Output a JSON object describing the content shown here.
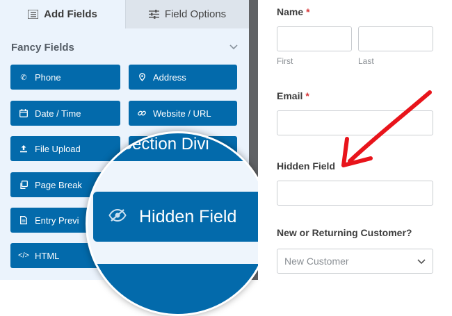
{
  "tabs": [
    {
      "label": "Add Fields",
      "icon": "list-icon"
    },
    {
      "label": "Field Options",
      "icon": "sliders-icon"
    }
  ],
  "section": {
    "title": "Fancy Fields"
  },
  "fields": [
    {
      "label": "Phone",
      "icon": "phone-icon"
    },
    {
      "label": "Address",
      "icon": "map-pin-icon"
    },
    {
      "label": "Date / Time",
      "icon": "calendar-icon"
    },
    {
      "label": "Website / URL",
      "icon": "link-icon"
    },
    {
      "label": "File Upload",
      "icon": "upload-icon"
    },
    {
      "label": "Page Break",
      "icon": "copy-icon"
    },
    {
      "label": "Entry Previ",
      "icon": "document-icon"
    },
    {
      "label": "HTML",
      "icon": "code-icon"
    }
  ],
  "magnifier": {
    "top_label": "Section Divi",
    "main_label": "Hidden Field",
    "main_icon": "eye-slash-icon"
  },
  "form": {
    "name": {
      "label": "Name",
      "required": "*",
      "first": "First",
      "last": "Last"
    },
    "email": {
      "label": "Email",
      "required": "*"
    },
    "hidden": {
      "label": "Hidden Field"
    },
    "customer": {
      "label": "New or Returning Customer?",
      "selected": "New Customer"
    }
  },
  "colors": {
    "button": "#036aab",
    "panel": "#ebf3fc",
    "required": "#d63638",
    "arrow": "#e8141b"
  }
}
